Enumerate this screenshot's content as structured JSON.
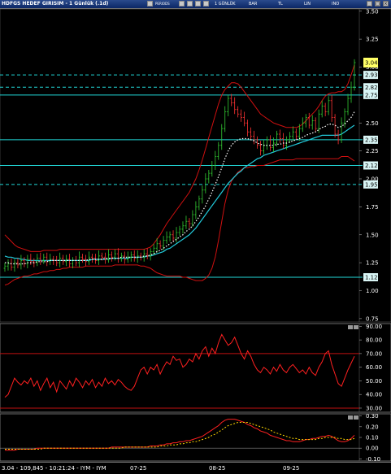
{
  "window": {
    "title": "HDFGS HEDEF GIRISIM - 1 Günlük (.1d)",
    "toolbar": [
      "1 GÜNLÜK",
      "BAR",
      "TL",
      "LIN",
      "INO"
    ],
    "toolbar_small": "PERIODS"
  },
  "status": {
    "text": "3.04 - 109,845 - 10:21:24 - IYM - IYM",
    "dates": [
      "07-25",
      "08-25",
      "09-25"
    ]
  },
  "colors": {
    "background": "#000000",
    "candle_up": "#33cc33",
    "candle_down": "#ff3333",
    "bollinger": "#d01010",
    "ma_slow": "#22c8d8",
    "ma_fast": "#ffffff",
    "level_line": "#22d8d8",
    "badge_price": "#ffff66",
    "badge_level": "#d8f5f5",
    "rsi_line": "#ff2020",
    "macd_line": "#ff2020",
    "macd_signal": "#ffd700"
  },
  "chart_data": [
    {
      "type": "candlestick",
      "title": "",
      "price_axis_ticks": [
        0.75,
        1.0,
        1.25,
        1.5,
        1.75,
        2.0,
        2.25,
        2.5,
        2.75,
        3.0,
        3.25,
        3.5
      ],
      "price_axis_labels": [
        "0.75",
        "1.00",
        "1.25",
        "1.50",
        "1.75",
        "2.00",
        "2.25",
        "2.50",
        "2.75",
        "3.00",
        "3.25",
        "3.50"
      ],
      "ylim": [
        0.72,
        3.52
      ],
      "x_date_labels": [
        "07-25",
        "08-25",
        "09-25"
      ],
      "last_price": 3.04,
      "horizontal_levels": [
        {
          "value": 2.93,
          "label": "2.93",
          "style": "dashed"
        },
        {
          "value": 2.82,
          "label": "2.82",
          "style": "dashed"
        },
        {
          "value": 2.75,
          "label": "2.75",
          "style": "solid"
        },
        {
          "value": 2.35,
          "label": "2.35",
          "style": "solid"
        },
        {
          "value": 2.12,
          "label": "2.12",
          "style": "solid"
        },
        {
          "value": 1.95,
          "label": "1.95",
          "style": "dashed"
        },
        {
          "value": 1.12,
          "label": "1.12",
          "style": "solid"
        }
      ],
      "closes": [
        1.22,
        1.24,
        1.21,
        1.25,
        1.23,
        1.27,
        1.24,
        1.28,
        1.26,
        1.25,
        1.29,
        1.27,
        1.3,
        1.26,
        1.28,
        1.27,
        1.25,
        1.29,
        1.26,
        1.28,
        1.24,
        1.27,
        1.25,
        1.3,
        1.28,
        1.26,
        1.3,
        1.29,
        1.27,
        1.31,
        1.3,
        1.28,
        1.32,
        1.3,
        1.33,
        1.29,
        1.31,
        1.28,
        1.3,
        1.32,
        1.29,
        1.31,
        1.3,
        1.33,
        1.31,
        1.35,
        1.38,
        1.42,
        1.4,
        1.45,
        1.48,
        1.5,
        1.47,
        1.52,
        1.55,
        1.58,
        1.62,
        1.6,
        1.68,
        1.75,
        1.82,
        1.9,
        2.0,
        2.05,
        2.12,
        2.2,
        2.3,
        2.45,
        2.6,
        2.72,
        2.68,
        2.62,
        2.58,
        2.55,
        2.5,
        2.42,
        2.38,
        2.35,
        2.3,
        2.25,
        2.3,
        2.35,
        2.28,
        2.32,
        2.4,
        2.36,
        2.3,
        2.35,
        2.38,
        2.42,
        2.38,
        2.45,
        2.5,
        2.55,
        2.48,
        2.52,
        2.45,
        2.58,
        2.65,
        2.6,
        2.7,
        2.55,
        2.4,
        2.35,
        2.5,
        2.6,
        2.72,
        2.82,
        3.04
      ],
      "bollinger_upper": [
        1.5,
        1.47,
        1.44,
        1.41,
        1.39,
        1.38,
        1.37,
        1.36,
        1.35,
        1.35,
        1.35,
        1.35,
        1.36,
        1.36,
        1.36,
        1.36,
        1.36,
        1.37,
        1.37,
        1.37,
        1.37,
        1.37,
        1.37,
        1.37,
        1.37,
        1.37,
        1.37,
        1.37,
        1.37,
        1.37,
        1.37,
        1.37,
        1.37,
        1.37,
        1.37,
        1.37,
        1.37,
        1.37,
        1.37,
        1.37,
        1.37,
        1.37,
        1.37,
        1.37,
        1.38,
        1.39,
        1.42,
        1.46,
        1.5,
        1.55,
        1.6,
        1.64,
        1.68,
        1.72,
        1.76,
        1.8,
        1.84,
        1.88,
        1.94,
        2.0,
        2.08,
        2.17,
        2.27,
        2.37,
        2.47,
        2.57,
        2.67,
        2.75,
        2.8,
        2.83,
        2.86,
        2.86,
        2.85,
        2.82,
        2.78,
        2.74,
        2.7,
        2.66,
        2.62,
        2.58,
        2.56,
        2.54,
        2.52,
        2.5,
        2.49,
        2.48,
        2.47,
        2.46,
        2.46,
        2.46,
        2.46,
        2.47,
        2.49,
        2.52,
        2.55,
        2.58,
        2.61,
        2.65,
        2.7,
        2.74,
        2.76,
        2.77,
        2.77,
        2.78,
        2.78,
        2.8,
        2.85,
        2.93,
        3.02
      ],
      "bollinger_lower": [
        1.05,
        1.06,
        1.08,
        1.1,
        1.11,
        1.12,
        1.13,
        1.13,
        1.14,
        1.15,
        1.15,
        1.16,
        1.17,
        1.17,
        1.18,
        1.18,
        1.19,
        1.19,
        1.2,
        1.2,
        1.21,
        1.21,
        1.21,
        1.21,
        1.21,
        1.22,
        1.22,
        1.22,
        1.22,
        1.22,
        1.22,
        1.22,
        1.22,
        1.22,
        1.23,
        1.23,
        1.23,
        1.23,
        1.23,
        1.23,
        1.23,
        1.23,
        1.22,
        1.22,
        1.21,
        1.2,
        1.18,
        1.16,
        1.15,
        1.14,
        1.13,
        1.13,
        1.13,
        1.13,
        1.13,
        1.12,
        1.12,
        1.11,
        1.1,
        1.09,
        1.09,
        1.09,
        1.11,
        1.14,
        1.2,
        1.3,
        1.45,
        1.62,
        1.78,
        1.9,
        1.98,
        2.02,
        2.06,
        2.08,
        2.1,
        2.1,
        2.11,
        2.11,
        2.12,
        2.12,
        2.12,
        2.13,
        2.14,
        2.15,
        2.16,
        2.17,
        2.17,
        2.17,
        2.17,
        2.17,
        2.18,
        2.18,
        2.18,
        2.18,
        2.18,
        2.18,
        2.18,
        2.18,
        2.18,
        2.18,
        2.18,
        2.18,
        2.18,
        2.18,
        2.2,
        2.2,
        2.2,
        2.18,
        2.16
      ],
      "ma_slow": [
        1.31,
        1.3,
        1.3,
        1.29,
        1.29,
        1.28,
        1.28,
        1.27,
        1.27,
        1.27,
        1.27,
        1.27,
        1.27,
        1.27,
        1.27,
        1.27,
        1.27,
        1.27,
        1.27,
        1.27,
        1.27,
        1.27,
        1.27,
        1.27,
        1.27,
        1.27,
        1.27,
        1.28,
        1.28,
        1.28,
        1.28,
        1.28,
        1.28,
        1.29,
        1.29,
        1.29,
        1.29,
        1.29,
        1.29,
        1.3,
        1.3,
        1.3,
        1.3,
        1.3,
        1.31,
        1.31,
        1.32,
        1.33,
        1.34,
        1.35,
        1.37,
        1.38,
        1.4,
        1.42,
        1.44,
        1.46,
        1.48,
        1.5,
        1.53,
        1.56,
        1.6,
        1.64,
        1.68,
        1.72,
        1.76,
        1.8,
        1.84,
        1.88,
        1.92,
        1.96,
        1.99,
        2.02,
        2.05,
        2.07,
        2.1,
        2.12,
        2.14,
        2.16,
        2.18,
        2.19,
        2.21,
        2.22,
        2.23,
        2.24,
        2.25,
        2.26,
        2.27,
        2.28,
        2.29,
        2.3,
        2.31,
        2.32,
        2.33,
        2.34,
        2.35,
        2.36,
        2.37,
        2.38,
        2.39,
        2.39,
        2.39,
        2.39,
        2.39,
        2.39,
        2.4,
        2.42,
        2.44,
        2.46,
        2.48
      ],
      "ma_fast": [
        1.25,
        1.25,
        1.24,
        1.24,
        1.24,
        1.24,
        1.24,
        1.25,
        1.25,
        1.25,
        1.26,
        1.26,
        1.26,
        1.26,
        1.27,
        1.27,
        1.27,
        1.27,
        1.27,
        1.27,
        1.27,
        1.27,
        1.27,
        1.27,
        1.27,
        1.27,
        1.28,
        1.28,
        1.28,
        1.28,
        1.28,
        1.29,
        1.29,
        1.29,
        1.29,
        1.29,
        1.3,
        1.3,
        1.3,
        1.3,
        1.3,
        1.3,
        1.3,
        1.31,
        1.31,
        1.32,
        1.33,
        1.35,
        1.36,
        1.38,
        1.4,
        1.42,
        1.44,
        1.46,
        1.48,
        1.5,
        1.53,
        1.55,
        1.58,
        1.62,
        1.66,
        1.71,
        1.76,
        1.82,
        1.88,
        1.95,
        2.02,
        2.1,
        2.18,
        2.25,
        2.3,
        2.33,
        2.35,
        2.36,
        2.36,
        2.36,
        2.35,
        2.34,
        2.32,
        2.31,
        2.3,
        2.3,
        2.3,
        2.3,
        2.31,
        2.31,
        2.32,
        2.32,
        2.33,
        2.34,
        2.35,
        2.36,
        2.37,
        2.39,
        2.4,
        2.41,
        2.42,
        2.44,
        2.46,
        2.47,
        2.49,
        2.49,
        2.48,
        2.46,
        2.47,
        2.49,
        2.52,
        2.55,
        2.6
      ]
    },
    {
      "type": "line",
      "title": "",
      "axis_labels": [
        "90.00",
        "80.00",
        "70.00",
        "60.00",
        "50.00",
        "40.00",
        "30.00"
      ],
      "ylim": [
        27,
        92
      ],
      "reference_lines": [
        70,
        30
      ],
      "values": [
        38,
        40,
        46,
        52,
        49,
        47,
        50,
        48,
        52,
        46,
        50,
        43,
        48,
        52,
        45,
        49,
        42,
        50,
        47,
        44,
        50,
        46,
        52,
        49,
        45,
        50,
        47,
        51,
        45,
        49,
        46,
        52,
        48,
        50,
        47,
        51,
        49,
        46,
        44,
        43,
        46,
        52,
        58,
        60,
        55,
        60,
        58,
        62,
        55,
        60,
        64,
        62,
        68,
        65,
        66,
        60,
        62,
        66,
        64,
        70,
        66,
        72,
        75,
        68,
        74,
        70,
        78,
        84,
        80,
        76,
        78,
        82,
        76,
        70,
        66,
        72,
        68,
        62,
        58,
        56,
        60,
        58,
        55,
        60,
        57,
        62,
        58,
        56,
        60,
        62,
        59,
        56,
        58,
        55,
        60,
        56,
        54,
        60,
        64,
        70,
        72,
        62,
        55,
        48,
        46,
        52,
        58,
        63,
        68
      ]
    },
    {
      "type": "line",
      "title": "",
      "axis_labels": [
        "0.30",
        "0.20",
        "0.10",
        "0.00",
        "-0.10"
      ],
      "ylim": [
        -0.12,
        0.32
      ],
      "reference_lines": [
        0.0
      ],
      "series": [
        {
          "values": [
            -0.02,
            -0.02,
            -0.02,
            -0.02,
            -0.01,
            -0.01,
            -0.01,
            -0.01,
            -0.01,
            -0.01,
            0.0,
            0.0,
            0.0,
            0.0,
            0.0,
            0.0,
            0.0,
            0.0,
            0.0,
            0.0,
            0.0,
            0.0,
            0.0,
            0.0,
            0.0,
            0.0,
            0.0,
            0.0,
            0.0,
            0.0,
            0.0,
            0.0,
            0.0,
            0.01,
            0.01,
            0.01,
            0.01,
            0.01,
            0.01,
            0.01,
            0.01,
            0.01,
            0.01,
            0.01,
            0.01,
            0.02,
            0.02,
            0.02,
            0.03,
            0.03,
            0.04,
            0.04,
            0.05,
            0.05,
            0.06,
            0.06,
            0.07,
            0.07,
            0.08,
            0.09,
            0.1,
            0.11,
            0.13,
            0.15,
            0.17,
            0.19,
            0.21,
            0.24,
            0.26,
            0.27,
            0.27,
            0.27,
            0.26,
            0.25,
            0.24,
            0.22,
            0.21,
            0.19,
            0.18,
            0.16,
            0.15,
            0.14,
            0.12,
            0.11,
            0.1,
            0.09,
            0.08,
            0.07,
            0.07,
            0.06,
            0.06,
            0.06,
            0.07,
            0.08,
            0.08,
            0.09,
            0.09,
            0.1,
            0.11,
            0.11,
            0.12,
            0.11,
            0.09,
            0.07,
            0.06,
            0.06,
            0.07,
            0.09,
            0.12
          ]
        },
        {
          "values": [
            -0.01,
            -0.01,
            -0.01,
            -0.01,
            -0.01,
            -0.01,
            -0.01,
            -0.01,
            -0.01,
            -0.01,
            -0.01,
            -0.01,
            0.0,
            0.0,
            0.0,
            0.0,
            0.0,
            0.0,
            0.0,
            0.0,
            0.0,
            0.0,
            0.0,
            0.0,
            0.0,
            0.0,
            0.0,
            0.0,
            0.0,
            0.0,
            0.0,
            0.0,
            0.0,
            0.0,
            0.0,
            0.0,
            0.0,
            0.01,
            0.01,
            0.01,
            0.01,
            0.01,
            0.01,
            0.01,
            0.01,
            0.01,
            0.01,
            0.01,
            0.02,
            0.02,
            0.02,
            0.03,
            0.03,
            0.03,
            0.04,
            0.04,
            0.05,
            0.05,
            0.06,
            0.06,
            0.07,
            0.08,
            0.09,
            0.1,
            0.12,
            0.13,
            0.15,
            0.17,
            0.19,
            0.21,
            0.22,
            0.23,
            0.24,
            0.24,
            0.24,
            0.24,
            0.23,
            0.22,
            0.21,
            0.2,
            0.19,
            0.18,
            0.17,
            0.15,
            0.14,
            0.13,
            0.12,
            0.11,
            0.1,
            0.09,
            0.09,
            0.08,
            0.08,
            0.08,
            0.08,
            0.08,
            0.08,
            0.09,
            0.09,
            0.1,
            0.1,
            0.1,
            0.1,
            0.09,
            0.09,
            0.08,
            0.08,
            0.08,
            0.09
          ]
        }
      ]
    }
  ]
}
